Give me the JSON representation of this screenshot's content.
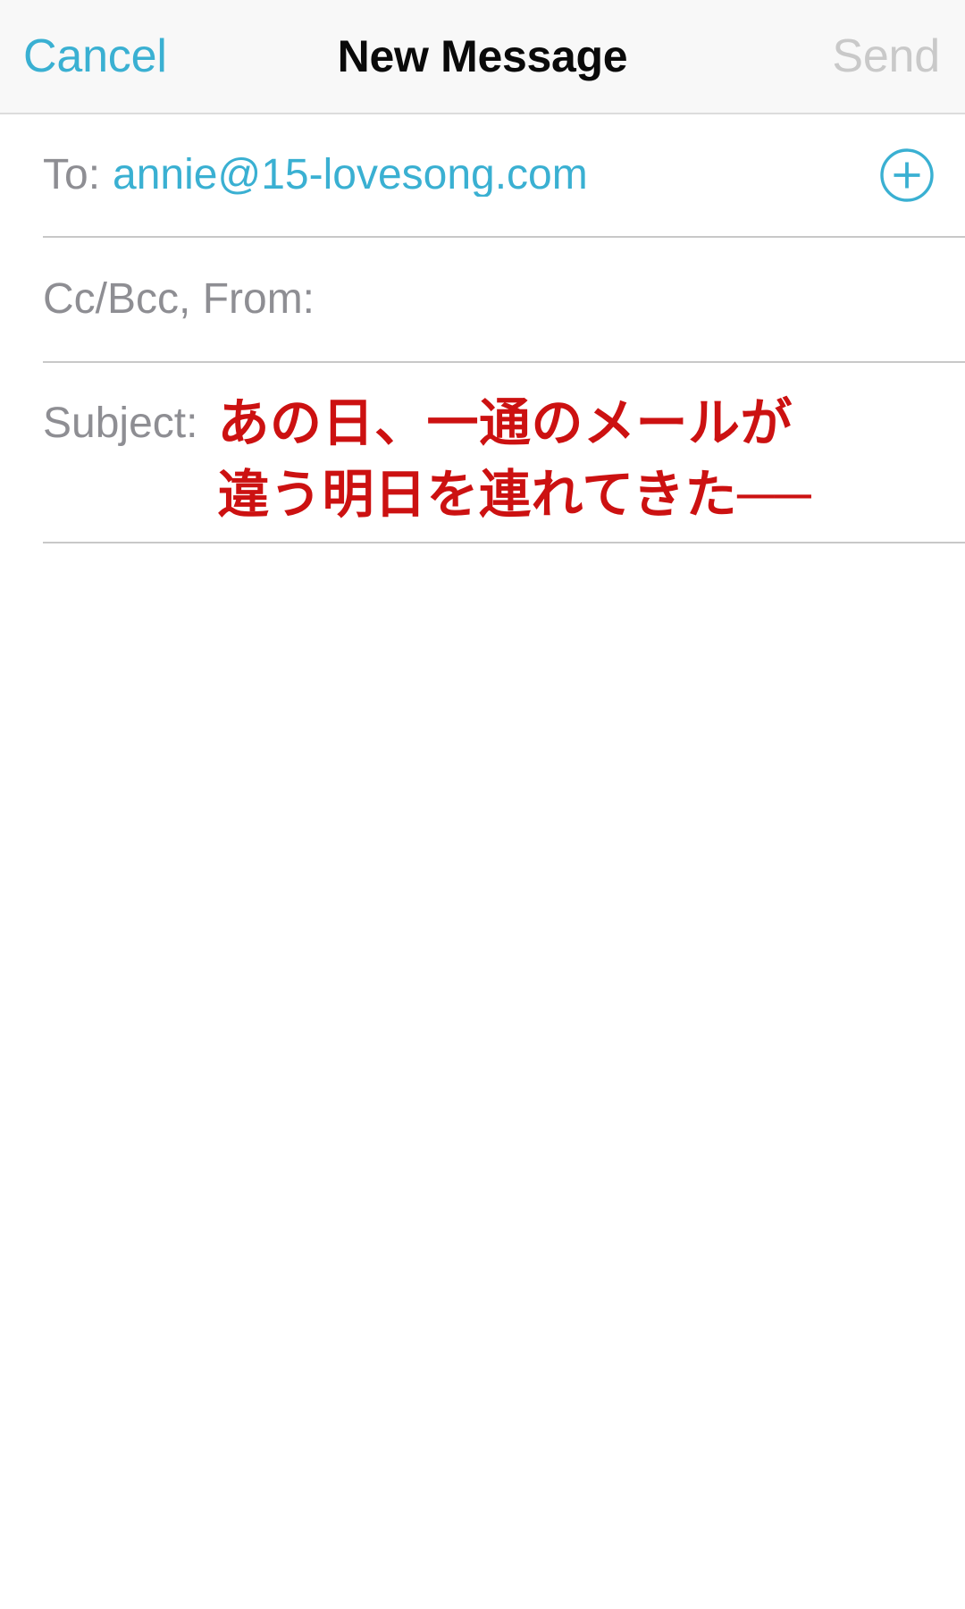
{
  "navbar": {
    "cancel_label": "Cancel",
    "title": "New Message",
    "send_label": "Send",
    "send_enabled": false,
    "accent_color": "#3ab0d2",
    "disabled_color": "#c9c9c9",
    "background_color": "#f8f8f8"
  },
  "compose": {
    "to": {
      "label": "To:",
      "value": "annie@15-lovesong.com",
      "placeholder": "",
      "value_color": "#3ab0d2",
      "add_contact_icon": "plus-circle-icon"
    },
    "cc_bcc_from": {
      "label": "Cc/Bcc, From:",
      "value": "",
      "placeholder": "Cc/Bcc, From:",
      "label_color": "#8e8e93"
    },
    "subject": {
      "label": "Subject:",
      "value": "あの日、一通のメールが違う明日を連れてきた──",
      "lines": [
        "あの日、一通のメールが",
        "違う明日を連れてきた──"
      ],
      "value_color": "#cc1111"
    },
    "body": {
      "value": "",
      "placeholder": ""
    },
    "label_color": "#8e8e93",
    "divider_color": "#c8c8c8"
  }
}
